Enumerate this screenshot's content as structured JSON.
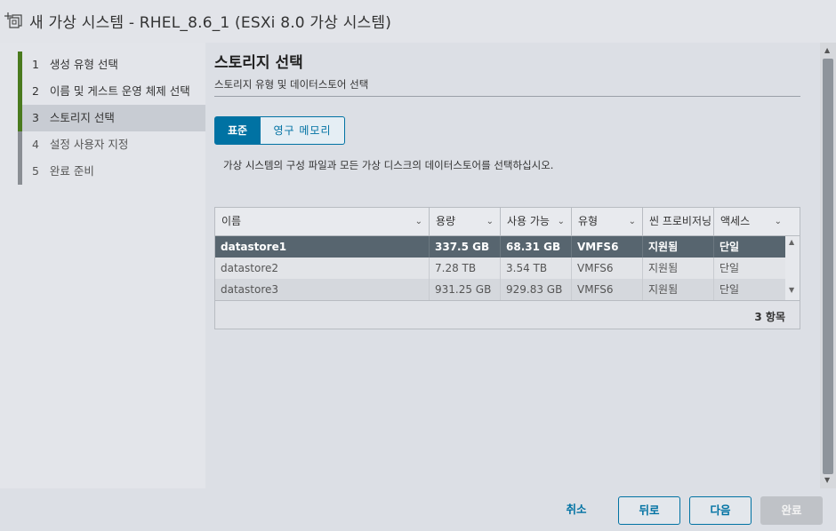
{
  "window": {
    "title": "새 가상 시스템 - RHEL_8.6_1 (ESXi 8.0 가상 시스템)",
    "icon": "new-vm-icon"
  },
  "steps": [
    {
      "num": "1",
      "label": "생성 유형 선택",
      "state": "done"
    },
    {
      "num": "2",
      "label": "이름 및 게스트 운영 체제 선택",
      "state": "done"
    },
    {
      "num": "3",
      "label": "스토리지 선택",
      "state": "current"
    },
    {
      "num": "4",
      "label": "설정 사용자 지정",
      "state": "future"
    },
    {
      "num": "5",
      "label": "완료 준비",
      "state": "future"
    }
  ],
  "page": {
    "title": "스토리지 선택",
    "subtitle": "스토리지 유형 및 데이터스토어 선택",
    "description": "가상 시스템의 구성 파일과 모든 가상 디스크의 데이터스토어를 선택하십시오."
  },
  "storage_type": {
    "options": [
      "표준",
      "영구 메모리"
    ],
    "selected": "표준"
  },
  "grid": {
    "columns": [
      "이름",
      "용량",
      "사용 가능",
      "유형",
      "씬 프로비저닝",
      "액세스"
    ],
    "rows": [
      [
        "datastore1",
        "337.5 GB",
        "68.31 GB",
        "VMFS6",
        "지원됨",
        "단일"
      ],
      [
        "datastore2",
        "7.28 TB",
        "3.54 TB",
        "VMFS6",
        "지원됨",
        "단일"
      ],
      [
        "datastore3",
        "931.25 GB",
        "929.83 GB",
        "VMFS6",
        "지원됨",
        "단일"
      ]
    ],
    "selected_row": 0,
    "count_label": "3 항목"
  },
  "footer": {
    "cancel": "취소",
    "back": "뒤로",
    "next": "다음",
    "finish": "완료"
  },
  "colors": {
    "accent": "#0072a3",
    "step_done": "#4a7a1e",
    "selected_row": "#57656f"
  }
}
